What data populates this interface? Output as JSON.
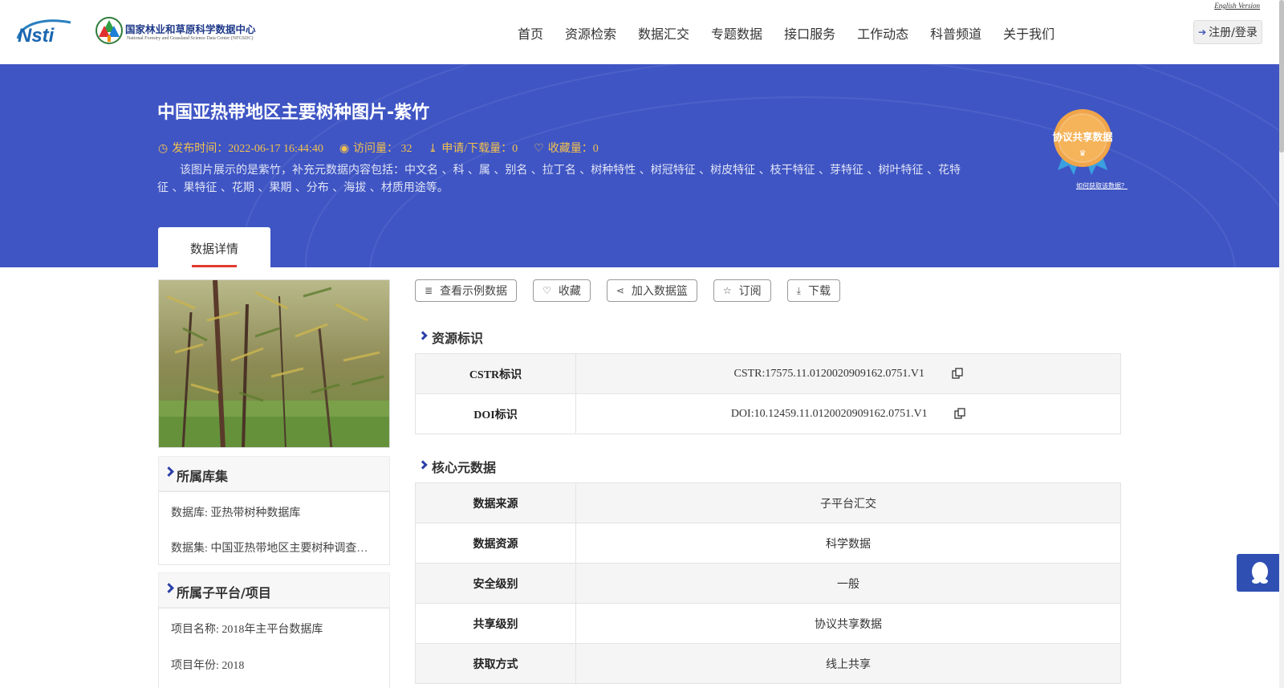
{
  "header": {
    "english_version": "English Version",
    "logo_cn": "国家林业和草原科学数据中心",
    "logo_en": "National Forestry and Grassland Science Data Center (NFGSDC)",
    "nav": [
      "首页",
      "资源检索",
      "数据汇交",
      "专题数据",
      "接口服务",
      "工作动态",
      "科普频道",
      "关于我们"
    ],
    "login": "注册/登录"
  },
  "banner": {
    "title": "中国亚热带地区主要树种图片-紫竹",
    "publish": "发布时间：2022-06-17 16:44:40",
    "visits": "访问量： 32",
    "downloads": "申请/下载量：0",
    "favorites": "收藏量：0",
    "description": "该图片展示的是紫竹，补充元数据内容包括：中文名 、科 、属 、别名 、拉丁名 、树种特性 、树冠特征 、树皮特征 、枝干特征 、芽特征 、树叶特征 、花特征 、果特征 、花期 、果期 、分布 、海拔 、材质用途等。",
    "badge_text": "协议共享数据",
    "badge_link": "如何获取该数据？",
    "tab": "数据详情"
  },
  "sidebar": {
    "library_title": "所属库集",
    "database": "数据库: 亚热带树种数据库",
    "dataset": "数据集: 中国亚热带地区主要树种调查数据集",
    "platform_title": "所属子平台/项目",
    "project_name": "项目名称: 2018年主平台数据库",
    "project_year": "项目年份: 2018"
  },
  "actions": [
    "查看示例数据",
    "收藏",
    "加入数据篮",
    "订阅",
    "下载"
  ],
  "resource": {
    "title": "资源标识",
    "rows": [
      {
        "k": "CSTR标识",
        "v": "CSTR:17575.11.0120020909162.0751.V1"
      },
      {
        "k": "DOI标识",
        "v": "DOI:10.12459.11.0120020909162.0751.V1"
      }
    ]
  },
  "core": {
    "title": "核心元数据",
    "rows": [
      {
        "k": "数据来源",
        "v": "子平台汇交"
      },
      {
        "k": "数据资源",
        "v": "科学数据"
      },
      {
        "k": "安全级别",
        "v": "一般"
      },
      {
        "k": "共享级别",
        "v": "协议共享数据"
      },
      {
        "k": "获取方式",
        "v": "线上共享"
      }
    ]
  }
}
